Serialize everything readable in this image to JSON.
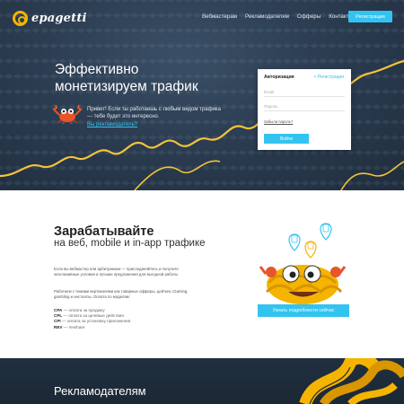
{
  "brand": {
    "name": "epagetti"
  },
  "nav": {
    "items": [
      "Вебмастерам",
      "Рекламодателям",
      "Офферы",
      "Контакты"
    ]
  },
  "header": {
    "register_label": "Регистрация"
  },
  "hero": {
    "title_line1": "Эффективно",
    "title_line2": "монетизируем трафик",
    "greeting": "Привет! Если ты работаешь с любым видом трафика — тебе будет это интересно.",
    "advertiser_link": "Вы рекламодатель?"
  },
  "auth": {
    "title": "Авторизация",
    "register_link": "+ Регистрация",
    "email_placeholder": "Email",
    "password_placeholder": "Пароль",
    "forgot_link": "Забыли пароль?",
    "login_button": "Войти"
  },
  "earn": {
    "title": "Зарабатывайте",
    "subtitle": "на веб, mobile и in-app трафике",
    "p1": "Если вы вебмастер или арбитражник — присоединяйтесь и получите эксклюзивные условия и лучшие предложения для выгодной работы",
    "p2": "Работаем с темами вертикалями как товарные офферы, дейтинг, iGaming, gambling и инсталлы. Оплата по моделям:",
    "models": [
      {
        "name": "CPA",
        "desc": "— оплата за продажу"
      },
      {
        "name": "CPL",
        "desc": "— оплата за целевые действия"
      },
      {
        "name": "CPI",
        "desc": "— оплата за установку приложения"
      },
      {
        "name": "REV",
        "desc": "— revshare"
      }
    ],
    "details_button": "Узнать подробности сейчас"
  },
  "advertisers": {
    "title": "Рекламодателям"
  },
  "colors": {
    "accent": "#33c3f0",
    "hero_bg": "#2c3d52",
    "brand_yellow": "#f5b400",
    "trend_line": "#f3c33a"
  }
}
